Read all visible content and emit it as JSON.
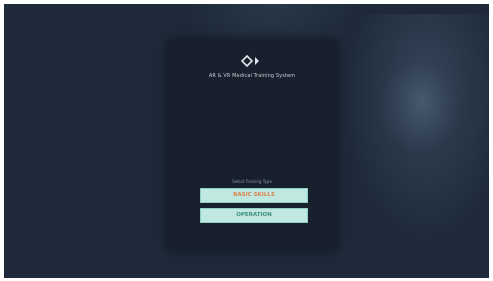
{
  "app": {
    "title": "AR & VR Medical Training System",
    "logo_icon": "diamond-arrows-icon"
  },
  "selection": {
    "label": "Select Training Type",
    "options": [
      {
        "label": "BASIC SKILLS"
      },
      {
        "label": "OPERATION"
      }
    ]
  },
  "colors": {
    "background": "#1e2a39",
    "panel": "#17202c",
    "button_fill": "#bfe8e0",
    "basic_skills_text": "#d9824b",
    "operation_text": "#3d8f7f"
  }
}
